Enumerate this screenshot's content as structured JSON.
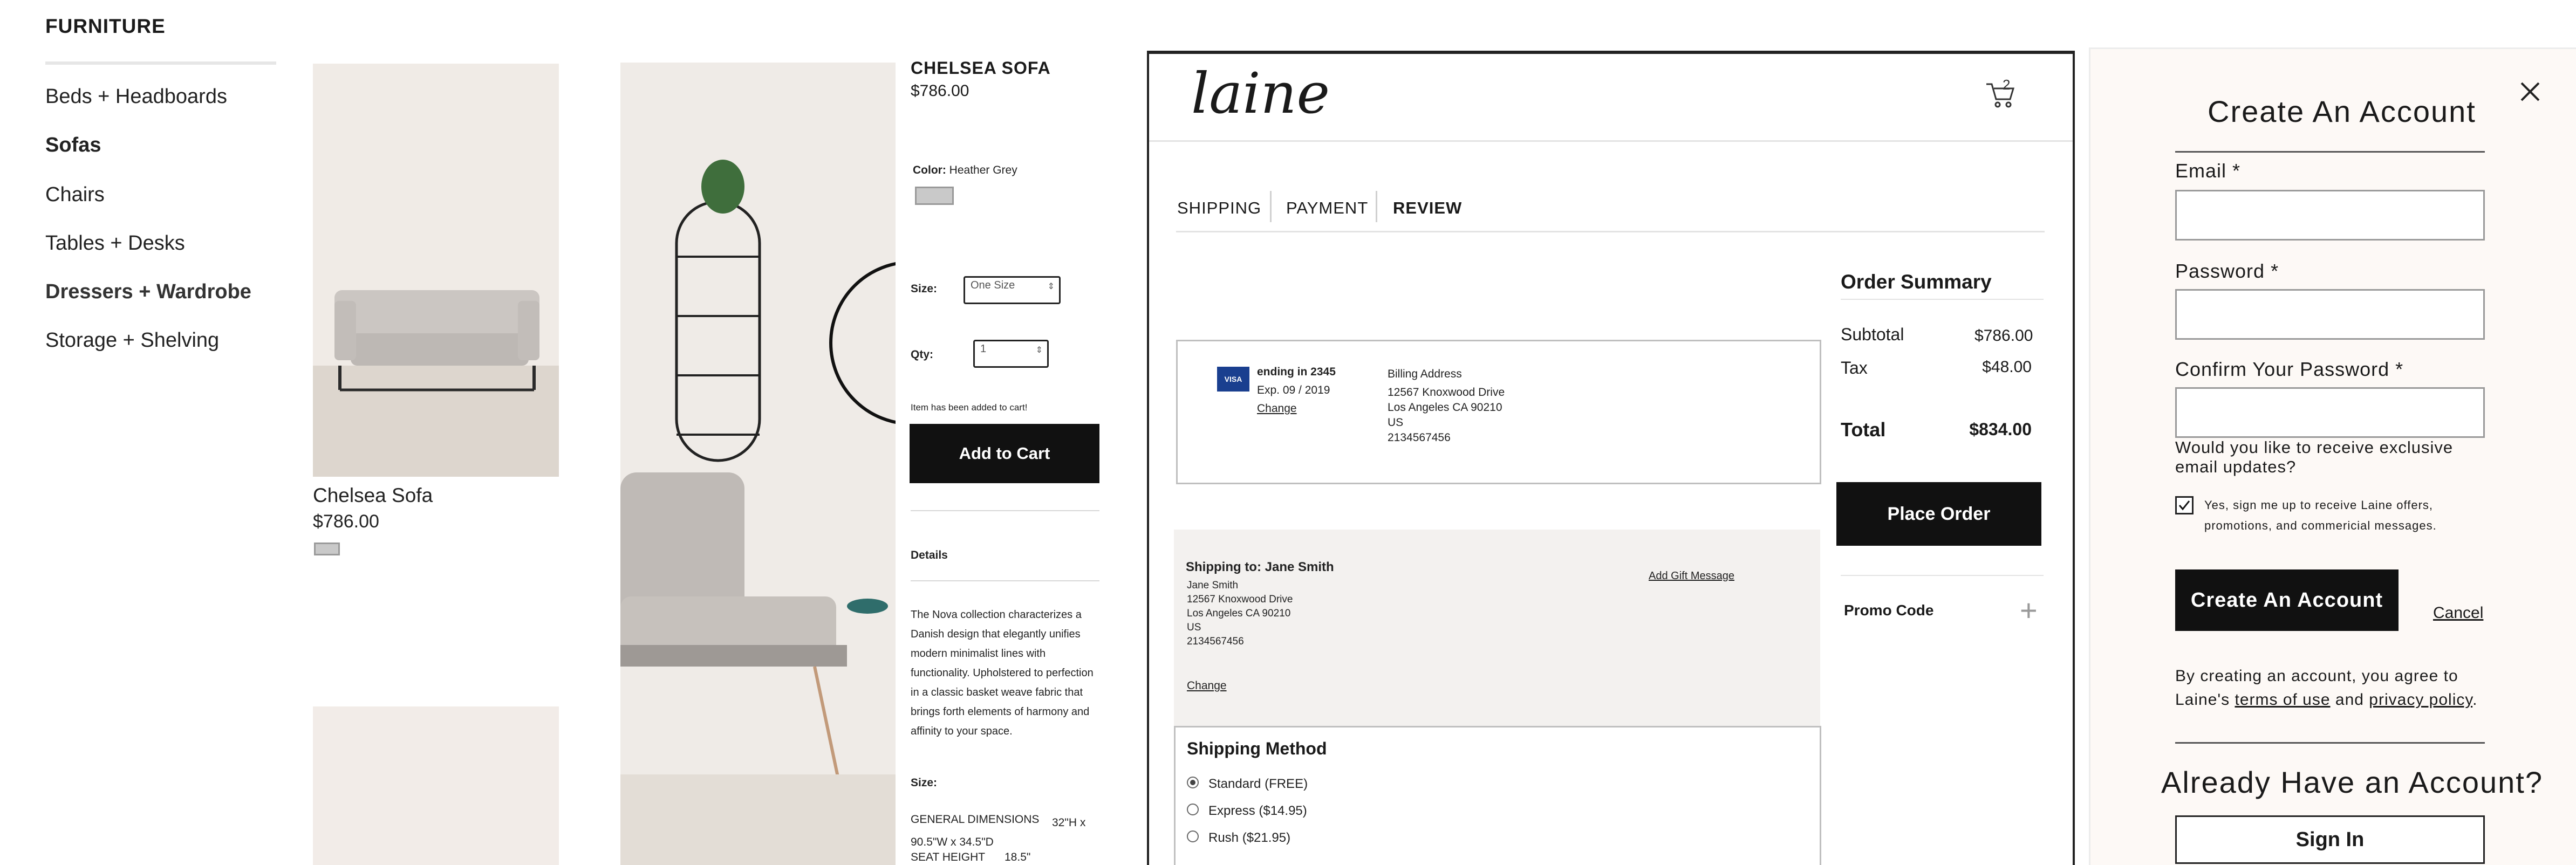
{
  "sidebar": {
    "heading": "FURNITURE",
    "items": [
      {
        "label": "Beds + Headboards"
      },
      {
        "label": "Sofas"
      },
      {
        "label": "Chairs"
      },
      {
        "label": "Tables + Desks"
      },
      {
        "label": "Dressers + Wardrobe"
      },
      {
        "label": "Storage + Shelving"
      }
    ]
  },
  "product_card": {
    "name": "Chelsea Sofa",
    "price": "$786.00"
  },
  "pdp": {
    "title": "CHELSEA SOFA",
    "price": "$786.00",
    "color_label": "Color:",
    "color_value": "Heather Grey",
    "size_label": "Size:",
    "size_value": "One Size",
    "qty_label": "Qty:",
    "qty_value": "1",
    "added_note": "Item has been added to cart!",
    "add_to_cart": "Add to Cart",
    "details_heading": "Details",
    "description": "The Nova collection characterizes a Danish design that elegantly unifies modern minimalist lines with functionality. Upholstered to perfection in a classic basket weave fabric that brings forth elements of harmony and affinity to your space.",
    "size_heading": "Size:",
    "dims_label": "GENERAL DIMENSIONS",
    "dims_value": "32\"H x 90.5\"W x 34.5\"D",
    "seat_label": "SEAT HEIGHT",
    "seat_value": "18.5\""
  },
  "checkout": {
    "logo": "laine",
    "cart_count": "2",
    "steps": [
      "SHIPPING",
      "PAYMENT",
      "REVIEW"
    ],
    "active_step": "REVIEW",
    "payment": {
      "card_brand": "VISA",
      "ending": "ending in 2345",
      "expiry": "Exp. 09 / 2019",
      "change": "Change",
      "billing_heading": "Billing Address",
      "billing_lines": [
        "12567 Knoxwood Drive",
        "Los Angeles CA 90210",
        "US",
        "2134567456"
      ]
    },
    "shipping": {
      "heading": "Shipping to: Jane Smith",
      "lines": [
        "Jane Smith",
        "12567 Knoxwood Drive",
        "Los Angeles CA 90210",
        "US",
        "2134567456"
      ],
      "change": "Change",
      "gift": "Add Gift Message"
    },
    "method": {
      "heading": "Shipping Method",
      "options": [
        {
          "label": "Standard (FREE)",
          "selected": true
        },
        {
          "label": "Express ($14.95)",
          "selected": false
        },
        {
          "label": "Rush ($21.95)",
          "selected": false
        }
      ]
    },
    "summary": {
      "heading": "Order Summary",
      "subtotal_label": "Subtotal",
      "subtotal": "$786.00",
      "tax_label": "Tax",
      "tax": "$48.00",
      "total_label": "Total",
      "total": "$834.00"
    },
    "place_order": "Place Order",
    "promo": "Promo Code"
  },
  "modal": {
    "title": "Create An Account",
    "email_label": "Email *",
    "password_label": "Password *",
    "confirm_label": "Confirm Your Password *",
    "updates_question": "Would you like to receive exclusive email updates?",
    "updates_checkbox_text": "Yes, sign me up to receive Laine offers, promotions, and commericial messages.",
    "updates_checked": true,
    "create_button": "Create An Account",
    "cancel": "Cancel",
    "terms_prefix": "By creating an account, you agree to Laine's",
    "terms_link": "terms of use",
    "terms_and": "and",
    "privacy_link": "privacy policy",
    "terms_suffix": ".",
    "already": "Already Have an Account?",
    "sign_in": "Sign In"
  }
}
